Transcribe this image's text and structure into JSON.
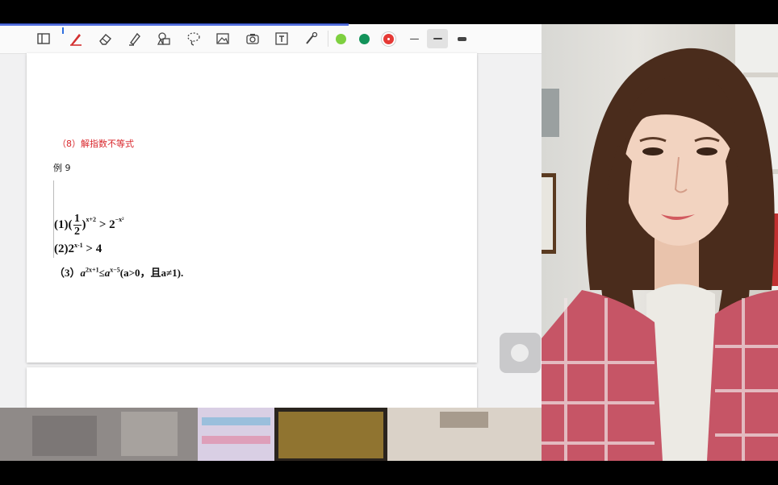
{
  "toolbar": {
    "tools": [
      "sidebar-toggle-icon",
      "pen-icon",
      "eraser-icon",
      "highlighter-icon",
      "shapes-icon",
      "lasso-icon",
      "image-icon",
      "camera-icon",
      "text-icon",
      "laser-pointer-icon"
    ],
    "colors": [
      "#7ed040",
      "#13935a",
      "#e53935"
    ],
    "line_widths": [
      "thin",
      "medium",
      "thick"
    ]
  },
  "document": {
    "section_title": "（8）解指数不等式",
    "example_label": "例 9",
    "problems": {
      "p1": {
        "prefix": "(1)(",
        "frac_num": "1",
        "frac_den": "2",
        "exp1": "x+2",
        "mid": " > 2",
        "exp2": "−x²"
      },
      "p2": {
        "prefix": "(2)2",
        "exp": "x-1",
        "suffix": " > 4"
      },
      "p3": {
        "prefix": "（3）",
        "base1": "a",
        "exp1": "2x+1",
        "rel": "≤",
        "base2": "a",
        "exp2": "x−5",
        "cond": "(a>0，且a≠1)."
      }
    }
  }
}
